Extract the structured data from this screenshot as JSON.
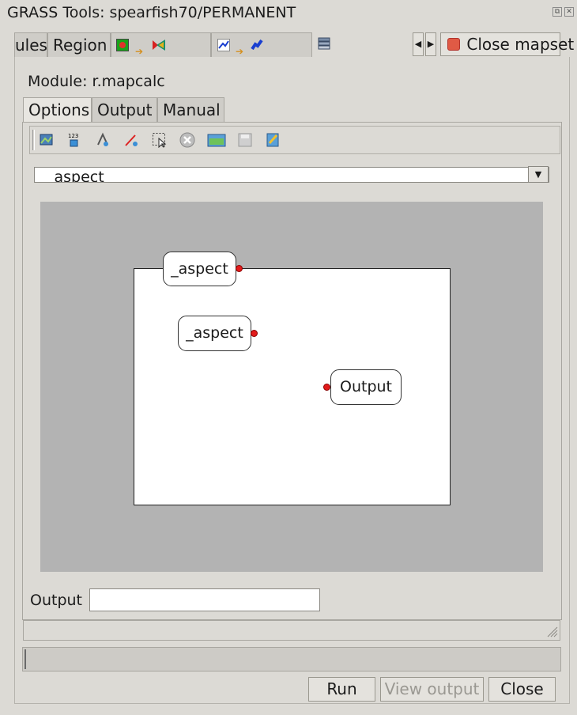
{
  "window": {
    "title": "GRASS Tools: spearfish70/PERMANENT"
  },
  "top_tabs": [
    {
      "label": "ules"
    },
    {
      "label": "Region"
    },
    {
      "icon": "raster-to-vector-icon"
    },
    {
      "icon": "vector-to-raster-icon"
    },
    {
      "icon": "layers-icon"
    }
  ],
  "close_mapset": {
    "label": "Close mapset"
  },
  "module": {
    "label": "Module: r.mapcalc"
  },
  "panel_tabs": [
    {
      "label": "Options",
      "selected": true
    },
    {
      "label": "Output",
      "selected": false
    },
    {
      "label": "Manual",
      "selected": false
    }
  ],
  "toolbar": {
    "tools": [
      "add-map-icon",
      "add-constant-icon",
      "add-function-icon",
      "add-relation-icon",
      "select-icon",
      "delete-icon",
      "open-icon",
      "save-icon",
      "edit-icon"
    ]
  },
  "expression": {
    "selected": "_aspect"
  },
  "canvas": {
    "nodes": [
      {
        "label": "_aspect"
      },
      {
        "label": "_aspect"
      },
      {
        "label": "Output"
      }
    ]
  },
  "output": {
    "label": "Output",
    "value": ""
  },
  "progress": {
    "fraction": 0.003
  },
  "buttons": {
    "run": "Run",
    "view_output": "View output",
    "close": "Close"
  },
  "colors": {
    "background": "#dcdad5",
    "canvas": "#b3b3b3",
    "handle": "#e21b1b"
  }
}
